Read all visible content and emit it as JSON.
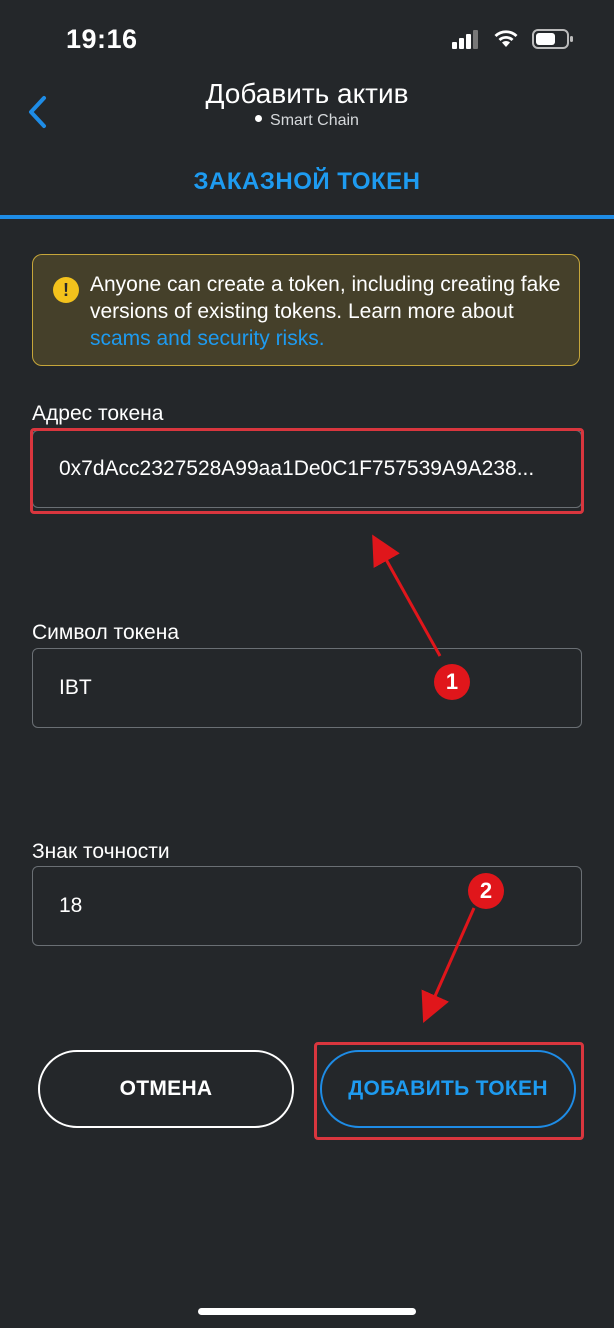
{
  "status_bar": {
    "time": "19:16",
    "icons": [
      "signal-icon",
      "wifi-icon",
      "battery-icon"
    ]
  },
  "header": {
    "title": "Добавить актив",
    "network": "Smart Chain"
  },
  "tab": {
    "label": "ЗАКАЗНОЙ ТОКЕН",
    "color": "#1e9bf0"
  },
  "warning": {
    "text": "Anyone can create a token, including creating fake versions of existing tokens. Learn more about ",
    "link_text": "scams and security risks.",
    "accent": "#f3c21c"
  },
  "form": {
    "address": {
      "label": "Адрес токена",
      "value": "0x7dAcc2327528A99aa1De0C1F757539A9A238..."
    },
    "symbol": {
      "label": "Символ токена",
      "value": "IBT"
    },
    "decimals": {
      "label": "Знак точности",
      "value": "18"
    }
  },
  "buttons": {
    "cancel": "ОТМЕНА",
    "add": "ДОБАВИТЬ ТОКЕН"
  },
  "annotations": {
    "step1": "1",
    "step2": "2",
    "color": "#e0161b"
  }
}
